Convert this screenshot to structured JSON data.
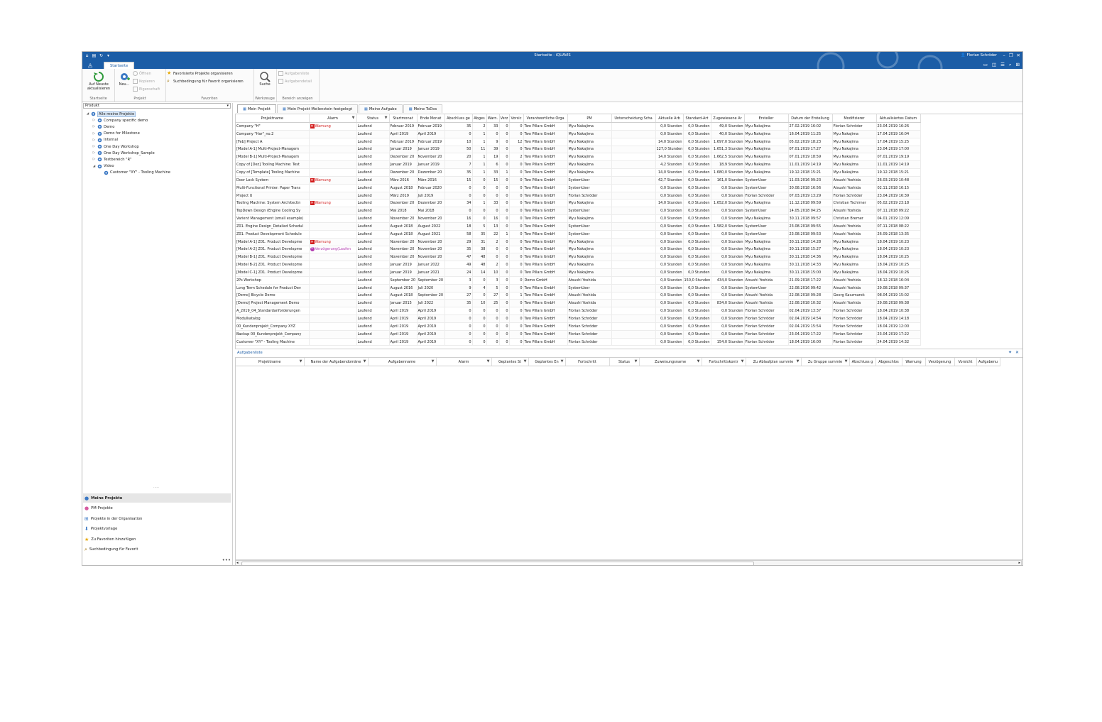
{
  "window": {
    "title": "Startseite - iQUAVIS",
    "user": "Florian Schröder"
  },
  "ribbon": {
    "tab": "Startseite",
    "refresh": "Auf Neuste aktualisieren",
    "group_startseite": "Startseite",
    "neu": "Neu...",
    "offnen": "Öffnen",
    "kopieren": "Kopieren",
    "eigenschaft": "Eigenschaft",
    "group_projekt": "Projekt",
    "fav_projects": "Favorisierte Projekte organisieren",
    "fav_search": "Suchbedingung für Favorit organisieren",
    "group_favoriten": "Favoriten",
    "suche": "Suche",
    "group_werkzeuge": "Werkzeuge",
    "aufgabenliste": "Aufgabenliste",
    "aufgabendetail": "Aufgabendetail",
    "group_bereich": "Bereich anzeigen"
  },
  "left": {
    "select_value": "Produkt",
    "tree": [
      {
        "label": "Alle meine Projekte",
        "level": 0,
        "exp": "◢"
      },
      {
        "label": "Company specific demo",
        "level": 1,
        "exp": "▷"
      },
      {
        "label": "Demo",
        "level": 1,
        "exp": "▷"
      },
      {
        "label": "Demo for Milestone",
        "level": 1,
        "exp": "▷"
      },
      {
        "label": "Internal",
        "level": 1,
        "exp": "▷"
      },
      {
        "label": "One Day Workshop",
        "level": 1,
        "exp": "▷"
      },
      {
        "label": "One Day Workshop_Sample",
        "level": 1,
        "exp": "▷"
      },
      {
        "label": "Testbereich \"R\"",
        "level": 1,
        "exp": "▷"
      },
      {
        "label": "Video",
        "level": 1,
        "exp": "◢"
      },
      {
        "label": "Customer \"XY\" - Tooling Machine",
        "level": 2,
        "exp": ""
      }
    ],
    "nav": [
      {
        "label": "Meine Projekte",
        "icon": "person-icon"
      },
      {
        "label": "PM-Projekte",
        "icon": "person-pink-icon"
      },
      {
        "label": "Projekte in der Organisation",
        "icon": "org-icon"
      },
      {
        "label": "Projektvorlage",
        "icon": "template-icon"
      },
      {
        "label": "Zu Favoriten hinzufügen",
        "icon": "star-icon"
      },
      {
        "label": "Suchbedingung für Favorit",
        "icon": "search-fav-icon"
      }
    ]
  },
  "tabs": [
    "Mein Projekt",
    "Mein Projekt Meilenstein festgelegt",
    "Meine Aufgabe",
    "Meine ToDos"
  ],
  "projects": {
    "columns": [
      "Projektname",
      "Alarm",
      "Status",
      "Startmonat",
      "Ende Monat",
      "Abschluss ge",
      "Abges",
      "Warn.",
      "Verz",
      "Vorsic",
      "Verantwortliche Orga",
      "PM",
      "Unterscheidung Scha",
      "Aktuelle Arb",
      "Standard-Art",
      "Zugewiesene Ar",
      "Ersteller",
      "Datum der Erstellung",
      "Modifizierer",
      "Aktualisiertes Datum"
    ],
    "rows": [
      [
        "Company \"H\"",
        "Warnung",
        "Laufend",
        "Februar 2019",
        "Februar 2019",
        "35",
        "2",
        "33",
        "0",
        "0",
        "Two Pillars GmbH",
        "Myu Nakajima",
        "",
        "0,0 Stunden",
        "0,0 Stunden",
        "49,0 Stunden",
        "Myu Nakajima",
        "27.02.2019 16:02",
        "Florian Schröder",
        "23.04.2019 16:26"
      ],
      [
        "Company \"Har\"_no.2",
        "",
        "Laufend",
        "April 2019",
        "April 2019",
        "0",
        "1",
        "0",
        "0",
        "0",
        "Two Pillars GmbH",
        "Myu Nakajima",
        "",
        "0,0 Stunden",
        "0,0 Stunden",
        "40,0 Stunden",
        "Myu Nakajima",
        "16.04.2019 11:25",
        "Myu Nakajima",
        "17.04.2019 16:04"
      ],
      [
        "[Feb] Project A",
        "",
        "Laufend",
        "Februar 2019",
        "Februar 2019",
        "10",
        "1",
        "9",
        "0",
        "12",
        "Two Pillars GmbH",
        "Myu Nakajima",
        "",
        "14,0 Stunden",
        "0,0 Stunden",
        "1.697,0 Stunden",
        "Myu Nakajima",
        "05.02.2019 18:23",
        "Myu Nakajima",
        "17.04.2019 15:25"
      ],
      [
        "[Model A-1] Multi-Project-Managem",
        "",
        "Laufend",
        "Januar 2019",
        "Januar 2019",
        "50",
        "11",
        "39",
        "0",
        "0",
        "Two Pillars GmbH",
        "Myu Nakajima",
        "",
        "127,0 Stunden",
        "0,0 Stunden",
        "1.651,3 Stunden",
        "Myu Nakajima",
        "07.01.2019 17:27",
        "Myu Nakajima",
        "23.04.2019 17:00"
      ],
      [
        "[Model B-1] Multi-Project-Managem",
        "",
        "Laufend",
        "Dezember 20",
        "November 20",
        "20",
        "1",
        "19",
        "0",
        "2",
        "Two Pillars GmbH",
        "Myu Nakajima",
        "",
        "14,0 Stunden",
        "0,0 Stunden",
        "1.662,5 Stunden",
        "Myu Nakajima",
        "07.01.2019 18:59",
        "Myu Nakajima",
        "07.01.2019 19:19"
      ],
      [
        "Copy of [Dez] Tooling Machine: Test",
        "",
        "Laufend",
        "Januar 2019",
        "Januar 2019",
        "7",
        "1",
        "6",
        "0",
        "0",
        "Two Pillars GmbH",
        "Myu Nakajima",
        "",
        "4,2 Stunden",
        "0,0 Stunden",
        "18,9 Stunden",
        "Myu Nakajima",
        "11.01.2019 14:19",
        "Myu Nakajima",
        "11.01.2019 14:19"
      ],
      [
        "Copy of [Template] Tooling Machine",
        "",
        "Laufend",
        "Dezember 20",
        "Dezember 20",
        "35",
        "1",
        "33",
        "1",
        "0",
        "Two Pillars GmbH",
        "Myu Nakajima",
        "",
        "14,0 Stunden",
        "0,0 Stunden",
        "1.680,0 Stunden",
        "Myu Nakajima",
        "19.12.2018 15:21",
        "Myu Nakajima",
        "19.12.2018 15:21"
      ],
      [
        "Door Lock System",
        "Warnung",
        "Laufend",
        "März 2016",
        "März 2016",
        "15",
        "0",
        "15",
        "0",
        "0",
        "Two Pillars GmbH",
        "SystemUser",
        "",
        "42,7 Stunden",
        "0,0 Stunden",
        "161,0 Stunden",
        "SystemUser",
        "11.03.2016 09:23",
        "Atsushi Yoshida",
        "26.03.2019 10:48"
      ],
      [
        "Multi-Functional Printer: Paper Trans",
        "",
        "Laufend",
        "August 2018",
        "Februar 2020",
        "0",
        "0",
        "0",
        "0",
        "0",
        "Two Pillars GmbH",
        "SystemUser",
        "",
        "0,0 Stunden",
        "0,0 Stunden",
        "0,0 Stunden",
        "SystemUser",
        "30.08.2018 16:56",
        "Atsushi Yoshida",
        "02.11.2018 16:15"
      ],
      [
        "Project U",
        "",
        "Laufend",
        "März 2019",
        "Juli 2019",
        "0",
        "0",
        "0",
        "0",
        "0",
        "Two Pillars GmbH",
        "Florian Schröder",
        "",
        "0,0 Stunden",
        "0,0 Stunden",
        "0,0 Stunden",
        "Florian Schröder",
        "07.03.2019 13:29",
        "Florian Schröder",
        "23.04.2019 16:39"
      ],
      [
        "Tooling Machine: System Architectin",
        "Warnung",
        "Laufend",
        "Dezember 20",
        "Dezember 20",
        "34",
        "1",
        "33",
        "0",
        "0",
        "Two Pillars GmbH",
        "Myu Nakajima",
        "",
        "14,0 Stunden",
        "0,0 Stunden",
        "1.652,0 Stunden",
        "Myu Nakajima",
        "11.12.2018 09:59",
        "Christian Tschirner",
        "05.02.2019 23:18"
      ],
      [
        "TopDown Design (Engine Cooling Sy",
        "",
        "Laufend",
        "Mai 2018",
        "Mai 2018",
        "0",
        "0",
        "0",
        "0",
        "0",
        "Two Pillars GmbH",
        "SystemUser",
        "",
        "0,0 Stunden",
        "0,0 Stunden",
        "0,0 Stunden",
        "SystemUser",
        "14.05.2018 04:25",
        "Atsushi Yoshida",
        "07.11.2018 09:22"
      ],
      [
        "Varient Management (small example)",
        "",
        "Laufend",
        "November 20",
        "November 20",
        "16",
        "0",
        "16",
        "0",
        "0",
        "Two Pillars GmbH",
        "Myu Nakajima",
        "",
        "0,0 Stunden",
        "0,0 Stunden",
        "0,0 Stunden",
        "Myu Nakajima",
        "30.11.2018 09:57",
        "Christian Bremer",
        "04.01.2019 12:09"
      ],
      [
        "Z01. Engine Design_Detailed Schedul",
        "",
        "Laufend",
        "August 2018",
        "August 2022",
        "18",
        "5",
        "13",
        "0",
        "0",
        "Two Pillars GmbH",
        "SystemUser",
        "",
        "0,0 Stunden",
        "0,0 Stunden",
        "1.582,0 Stunden",
        "SystemUser",
        "23.08.2018 09:55",
        "Atsushi Yoshida",
        "07.11.2018 08:22"
      ],
      [
        "Z01. Product Development Schedule",
        "",
        "Laufend",
        "August 2018",
        "August 2021",
        "58",
        "35",
        "22",
        "1",
        "0",
        "Two Pillars GmbH",
        "SystemUser",
        "",
        "0,0 Stunden",
        "0,0 Stunden",
        "0,0 Stunden",
        "SystemUser",
        "23.08.2018 09:53",
        "Atsushi Yoshida",
        "26.09.2018 13:35"
      ],
      [
        "[Model A-1] Z01. Product Developme",
        "Warnung",
        "Laufend",
        "November 20",
        "November 20",
        "29",
        "31",
        "2",
        "0",
        "0",
        "Two Pillars GmbH",
        "Myu Nakajima",
        "",
        "0,0 Stunden",
        "0,0 Stunden",
        "0,0 Stunden",
        "Myu Nakajima",
        "30.11.2018 14:28",
        "Myu Nakajima",
        "18.04.2019 10:23"
      ],
      [
        "[Model A-2] Z01. Product Developme",
        "Verzögerung(Laufen",
        "Laufend",
        "November 20",
        "November 20",
        "35",
        "38",
        "0",
        "0",
        "0",
        "Two Pillars GmbH",
        "Myu Nakajima",
        "",
        "0,0 Stunden",
        "0,0 Stunden",
        "0,0 Stunden",
        "Myu Nakajima",
        "30.11.2018 15:27",
        "Myu Nakajima",
        "18.04.2019 10:23"
      ],
      [
        "[Model B-1] Z01. Product Developme",
        "",
        "Laufend",
        "November 20",
        "November 20",
        "47",
        "48",
        "0",
        "0",
        "0",
        "Two Pillars GmbH",
        "Myu Nakajima",
        "",
        "0,0 Stunden",
        "0,0 Stunden",
        "0,0 Stunden",
        "Myu Nakajima",
        "30.11.2018 14:36",
        "Myu Nakajima",
        "18.04.2019 10:25"
      ],
      [
        "[Model B-2] Z01. Product Developme",
        "",
        "Laufend",
        "Januar 2019",
        "Januar 2022",
        "49",
        "48",
        "2",
        "0",
        "0",
        "Two Pillars GmbH",
        "Myu Nakajima",
        "",
        "0,0 Stunden",
        "0,0 Stunden",
        "0,0 Stunden",
        "Myu Nakajima",
        "30.11.2018 14:33",
        "Myu Nakajima",
        "18.04.2019 10:25"
      ],
      [
        "[Model C-1] Z01. Product Developme",
        "",
        "Laufend",
        "Januar 2019",
        "Januar 2021",
        "24",
        "14",
        "10",
        "0",
        "0",
        "Two Pillars GmbH",
        "Myu Nakajima",
        "",
        "0,0 Stunden",
        "0,0 Stunden",
        "0,0 Stunden",
        "Myu Nakajima",
        "30.11.2018 15:00",
        "Myu Nakajima",
        "18.04.2019 10:26"
      ],
      [
        "2Ps Workshop",
        "",
        "Laufend",
        "September 20",
        "September 20",
        "3",
        "0",
        "3",
        "0",
        "0",
        "Demo GmbH",
        "Atsushi Yoshida",
        "",
        "0,0 Stunden",
        "150,0 Stunden",
        "434,0 Stunden",
        "Atsushi Yoshida",
        "21.09.2018 17:22",
        "Atsushi Yoshida",
        "18.12.2018 16:04"
      ],
      [
        "Long Term Schedule for Product Dev",
        "",
        "Laufend",
        "August 2016",
        "Juli 2020",
        "9",
        "4",
        "5",
        "0",
        "0",
        "Two Pillars GmbH",
        "SystemUser",
        "",
        "0,0 Stunden",
        "0,0 Stunden",
        "0,0 Stunden",
        "SystemUser",
        "22.08.2016 09:42",
        "Atsushi Yoshida",
        "29.08.2018 09:37"
      ],
      [
        "[Demo] Bicycle Demo",
        "",
        "Laufend",
        "August 2018",
        "September 20",
        "27",
        "0",
        "27",
        "0",
        "1",
        "Two Pillars GmbH",
        "Atsushi Yoshida",
        "",
        "0,0 Stunden",
        "0,0 Stunden",
        "0,0 Stunden",
        "Atsushi Yoshida",
        "22.08.2018 09:28",
        "Georg Kaczmarek",
        "08.04.2019 15:02"
      ],
      [
        "[Demo] Project Management Demo",
        "",
        "Laufend",
        "Januar 2015",
        "Juli 2022",
        "35",
        "10",
        "25",
        "0",
        "0",
        "Two Pillars GmbH",
        "Atsushi Yoshida",
        "",
        "0,0 Stunden",
        "0,0 Stunden",
        "834,0 Stunden",
        "Atsushi Yoshida",
        "22.08.2018 10:32",
        "Atsushi Yoshida",
        "29.08.2018 09:38"
      ],
      [
        "A_2019_04_Standardanforderungen",
        "",
        "Laufend",
        "April 2019",
        "April 2019",
        "0",
        "0",
        "0",
        "0",
        "0",
        "Two Pillars GmbH",
        "Florian Schröder",
        "",
        "0,0 Stunden",
        "0,0 Stunden",
        "0,0 Stunden",
        "Florian Schröder",
        "02.04.2019 13:37",
        "Florian Schröder",
        "18.04.2019 10:38"
      ],
      [
        "Modulkatalog",
        "",
        "Laufend",
        "April 2019",
        "April 2019",
        "0",
        "0",
        "0",
        "0",
        "0",
        "Two Pillars GmbH",
        "Florian Schröder",
        "",
        "0,0 Stunden",
        "0,0 Stunden",
        "0,0 Stunden",
        "Florian Schröder",
        "02.04.2019 14:54",
        "Florian Schröder",
        "18.04.2019 14:18"
      ],
      [
        "00_Kundenprojekt_Company XYZ",
        "",
        "Laufend",
        "April 2019",
        "April 2019",
        "0",
        "0",
        "0",
        "0",
        "0",
        "Two Pillars GmbH",
        "Florian Schröder",
        "",
        "0,0 Stunden",
        "0,0 Stunden",
        "0,0 Stunden",
        "Florian Schröder",
        "02.04.2019 15:54",
        "Florian Schröder",
        "18.04.2019 12:00"
      ],
      [
        "Backup 00_Kundenprojekt_Company",
        "",
        "Laufend",
        "April 2019",
        "April 2019",
        "0",
        "0",
        "0",
        "0",
        "0",
        "Two Pillars GmbH",
        "Florian Schröder",
        "",
        "0,0 Stunden",
        "0,0 Stunden",
        "0,0 Stunden",
        "Florian Schröder",
        "23.04.2019 17:22",
        "Florian Schröder",
        "23.04.2019 17:22"
      ],
      [
        "Customer \"XY\" - Tooling Machine",
        "",
        "Laufend",
        "April 2019",
        "April 2019",
        "0",
        "0",
        "0",
        "0",
        "0",
        "Two Pillars GmbH",
        "Florian Schröder",
        "",
        "0,0 Stunden",
        "0,0 Stunden",
        "154,0 Stunden",
        "Florian Schröder",
        "18.04.2019 16:00",
        "Florian Schröder",
        "24.04.2019 14:32"
      ]
    ]
  },
  "tasks": {
    "title": "Aufgabenliste",
    "columns": [
      "Projektname",
      "Name der Aufgabendomäne",
      "Aufgabenname",
      "Alarm",
      "Geplantes St",
      "Geplantes En",
      "Fortschritt",
      "Status",
      "Zuweisungsname",
      "Fortschrittskontr",
      "Zu Ablaufplan summie",
      "Zu Gruppe summie",
      "Abschluss g",
      "Abgeschlos",
      "Warnung",
      "Verzögerung",
      "Vorsicht",
      "Aufgabenu"
    ]
  }
}
